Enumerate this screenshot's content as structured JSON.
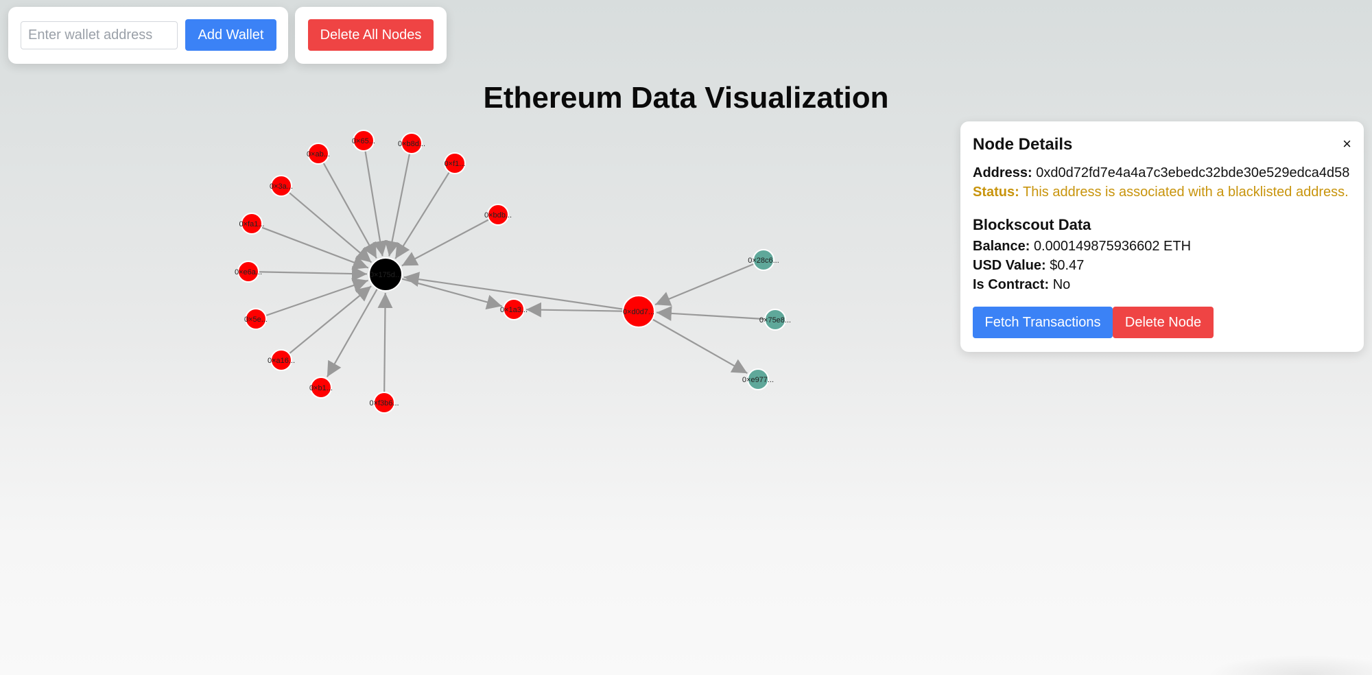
{
  "toolbar": {
    "wallet_placeholder": "Enter wallet address",
    "add_wallet_label": "Add Wallet",
    "delete_all_label": "Delete All Nodes"
  },
  "page_title": "Ethereum Data Visualization",
  "colors": {
    "blue_button": "#3b82f6",
    "red_button": "#ef4444",
    "node_red": "#ff0000",
    "node_teal": "#5fa89a",
    "node_black": "#000000",
    "edge_gray": "#999999",
    "status_warning": "#c8940c"
  },
  "graph": {
    "nodes": [
      {
        "id": "hub",
        "label": "0×175d...",
        "color": "black",
        "size": "large"
      },
      {
        "id": "a",
        "label": "0×ab...",
        "color": "red"
      },
      {
        "id": "b",
        "label": "0×65...",
        "color": "red"
      },
      {
        "id": "c",
        "label": "0×b8d...",
        "color": "red"
      },
      {
        "id": "d",
        "label": "0×f1...",
        "color": "red"
      },
      {
        "id": "e",
        "label": "0×bdb...",
        "color": "red"
      },
      {
        "id": "f",
        "label": "0×3a...",
        "color": "red"
      },
      {
        "id": "g",
        "label": "0×fa1...",
        "color": "red"
      },
      {
        "id": "h",
        "label": "0×e6a...",
        "color": "red"
      },
      {
        "id": "i",
        "label": "0×5e...",
        "color": "red"
      },
      {
        "id": "j",
        "label": "0×a16...",
        "color": "red"
      },
      {
        "id": "k",
        "label": "0×b1...",
        "color": "red"
      },
      {
        "id": "l",
        "label": "0×f3b6...",
        "color": "red"
      },
      {
        "id": "m",
        "label": "0×1a3...",
        "color": "red"
      },
      {
        "id": "sel",
        "label": "0×d0d7...",
        "color": "red",
        "size": "large"
      },
      {
        "id": "t1",
        "label": "0×28c6...",
        "color": "teal"
      },
      {
        "id": "t2",
        "label": "0×75e8...",
        "color": "teal"
      },
      {
        "id": "t3",
        "label": "0×e977...",
        "color": "teal"
      }
    ],
    "edges": [
      {
        "from": "a",
        "to": "hub"
      },
      {
        "from": "b",
        "to": "hub"
      },
      {
        "from": "c",
        "to": "hub"
      },
      {
        "from": "d",
        "to": "hub"
      },
      {
        "from": "e",
        "to": "hub"
      },
      {
        "from": "f",
        "to": "hub"
      },
      {
        "from": "g",
        "to": "hub"
      },
      {
        "from": "h",
        "to": "hub"
      },
      {
        "from": "i",
        "to": "hub"
      },
      {
        "from": "j",
        "to": "hub"
      },
      {
        "from": "hub",
        "to": "k"
      },
      {
        "from": "l",
        "to": "hub"
      },
      {
        "from": "hub",
        "to": "m"
      },
      {
        "from": "sel",
        "to": "hub"
      },
      {
        "from": "sel",
        "to": "m"
      },
      {
        "from": "t1",
        "to": "sel"
      },
      {
        "from": "t2",
        "to": "sel"
      },
      {
        "from": "sel",
        "to": "t3"
      }
    ]
  },
  "details": {
    "title": "Node Details",
    "close_symbol": "×",
    "address_label": "Address:",
    "address_value": "0xd0d72fd7e4a4a7c3ebedc32bde30e529edca4d58",
    "status_label": "Status:",
    "status_value": "This address is associated with a blacklisted address.",
    "blockscout_title": "Blockscout Data",
    "balance_label": "Balance:",
    "balance_value": "0.000149875936602 ETH",
    "usd_label": "USD Value:",
    "usd_value": "$0.47",
    "contract_label": "Is Contract:",
    "contract_value": "No",
    "fetch_label": "Fetch Transactions",
    "delete_label": "Delete Node"
  }
}
